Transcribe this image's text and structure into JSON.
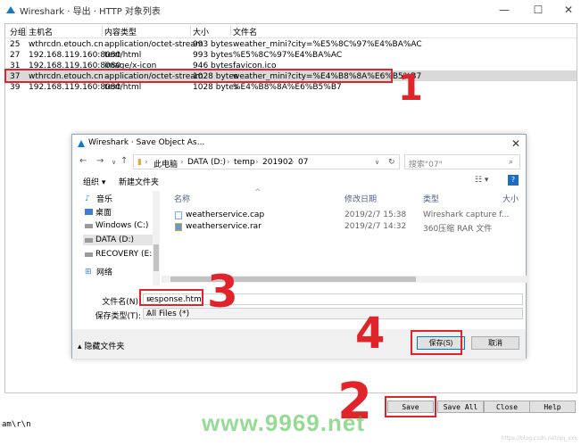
{
  "window": {
    "title": "Wireshark · 导出 · HTTP 对象列表",
    "minimize": "—",
    "maximize": "☐",
    "close": "✕"
  },
  "list": {
    "columns": [
      "分组",
      "主机名",
      "内容类型",
      "大小",
      "文件名"
    ],
    "rows": [
      {
        "num": "25",
        "host": "wthrcdn.etouch.cn",
        "type": "application/octet-stream",
        "size": "993 bytes",
        "file": "weather_mini?city=%E5%8C%97%E4%BA%AC"
      },
      {
        "num": "27",
        "host": "192.168.119.160:8080",
        "type": "text/html",
        "size": "993 bytes",
        "file": "%E5%8C%97%E4%BA%AC"
      },
      {
        "num": "31",
        "host": "192.168.119.160:8080",
        "type": "image/x-icon",
        "size": "946 bytes",
        "file": "favicon.ico"
      },
      {
        "num": "37",
        "host": "wthrcdn.etouch.cn",
        "type": "application/octet-stream",
        "size": "1028 bytes",
        "file": "weather_mini?city=%E4%B8%8A%E6%B5%B7"
      },
      {
        "num": "39",
        "host": "192.168.119.160:8080",
        "type": "text/html",
        "size": "1028 bytes",
        "file": "%E4%B8%8A%E6%B5%B7"
      }
    ]
  },
  "annotations": {
    "a1": "1",
    "a2": "2",
    "a3": "3",
    "a4": "4"
  },
  "bottom_buttons": {
    "save": "Save",
    "save_all": "Save All",
    "close": "Close",
    "help": "Help"
  },
  "bottom_text": "am\\r\\n",
  "watermark": "www.9969.net",
  "credit": "https://blog.csdn.net/qq_xxx",
  "dialog": {
    "title": "Wireshark · Save Object As...",
    "close": "✕",
    "path": [
      "此电脑",
      "DATA (D:)",
      "temp",
      "201902",
      "07"
    ],
    "search_placeholder": "搜索\"07\"",
    "organize": "组织 ▾",
    "new_folder": "新建文件夹",
    "left_items": [
      "音乐",
      "桌面",
      "Windows (C:)",
      "DATA (D:)",
      "RECOVERY (E:)",
      "网络"
    ],
    "file_columns": {
      "name": "名称",
      "modified": "修改日期",
      "type": "类型",
      "size": "大小"
    },
    "files": [
      {
        "name": "weatherservice.cap",
        "modified": "2019/2/7 15:38",
        "type": "Wireshark capture f..."
      },
      {
        "name": "weatherservice.rar",
        "modified": "2019/2/7 14:32",
        "type": "360压缩 RAR 文件"
      }
    ],
    "filename_label": "文件名(N):",
    "filename_value": "response.html",
    "filetype_label": "保存类型(T):",
    "filetype_value": "All Files  (*)",
    "hide_folders": "隐藏文件夹",
    "save_button": "保存(S)",
    "cancel_button": "取消"
  },
  "colors": {
    "annotation_red": "#e0242a",
    "selected_row": "#d9d9d9",
    "accent": "#0078d7"
  }
}
